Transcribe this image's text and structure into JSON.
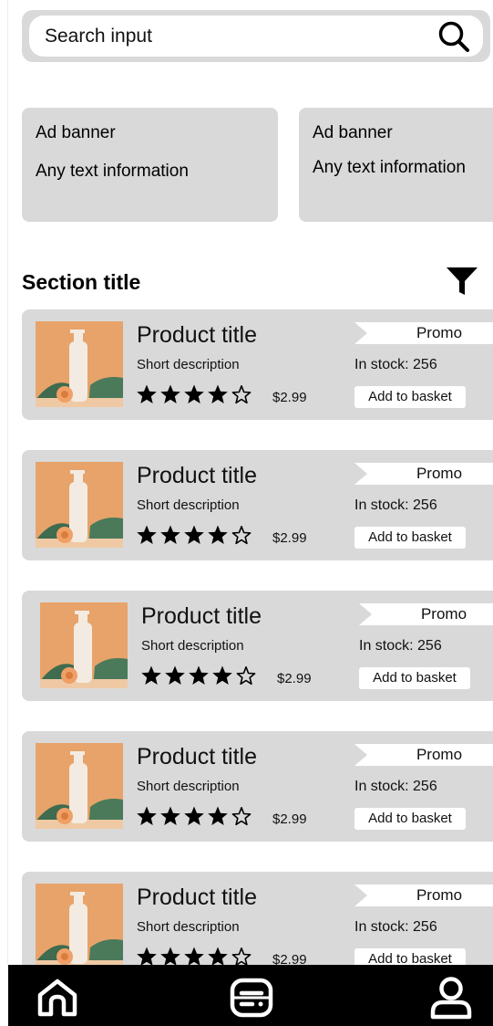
{
  "search": {
    "placeholder": "Search input"
  },
  "banners": [
    {
      "title": "Ad banner",
      "text": "Any text information"
    },
    {
      "title": "Ad banner",
      "text": "Any text information"
    }
  ],
  "section": {
    "title": "Section title"
  },
  "products": [
    {
      "title": "Product title",
      "description": "Short description",
      "rating": 4,
      "rating_max": 5,
      "price": "$2.99",
      "promo": "Promo",
      "stock": "In stock: 256",
      "basket_label": "Add to basket"
    },
    {
      "title": "Product title",
      "description": "Short description",
      "rating": 4,
      "rating_max": 5,
      "price": "$2.99",
      "promo": "Promo",
      "stock": "In stock: 256",
      "basket_label": "Add to basket"
    },
    {
      "title": "Product title",
      "description": "Short description",
      "rating": 4,
      "rating_max": 5,
      "price": "$2.99",
      "promo": "Promo",
      "stock": "In stock: 256",
      "basket_label": "Add to basket"
    },
    {
      "title": "Product title",
      "description": "Short description",
      "rating": 4,
      "rating_max": 5,
      "price": "$2.99",
      "promo": "Promo",
      "stock": "In stock: 256",
      "basket_label": "Add to basket"
    },
    {
      "title": "Product title",
      "description": "Short description",
      "rating": 4,
      "rating_max": 5,
      "price": "$2.99",
      "promo": "Promo",
      "stock": "In stock: 256",
      "basket_label": "Add to basket"
    }
  ],
  "nav": {
    "items": [
      {
        "icon": "home-icon"
      },
      {
        "icon": "catalog-icon"
      },
      {
        "icon": "profile-icon"
      }
    ]
  },
  "colors": {
    "card_bg": "#d9d9d9",
    "nav_bg": "#000000",
    "thumb_bg": "#e8a870"
  }
}
